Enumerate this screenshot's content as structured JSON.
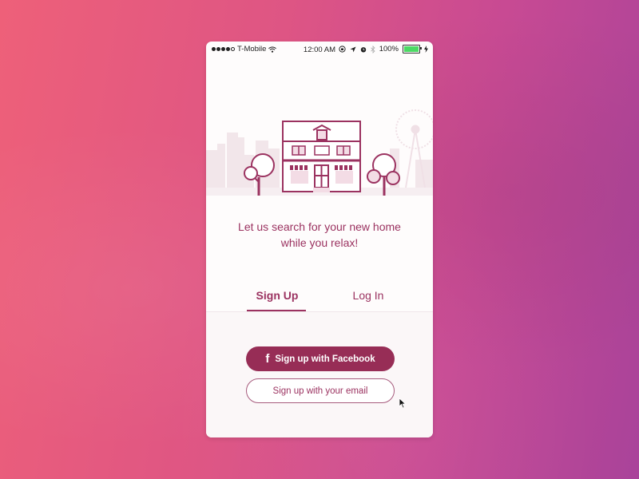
{
  "status_bar": {
    "carrier": "T-Mobile",
    "signal_bars_filled": 4,
    "signal_bars_total": 5,
    "time": "12:00 AM",
    "battery_percent": "100%",
    "icons": [
      "wifi-icon",
      "orientation-lock-icon",
      "location-arrow-icon",
      "alarm-icon",
      "bluetooth-icon",
      "battery-icon",
      "charging-bolt-icon"
    ]
  },
  "illustration": {
    "description": "house-with-trees-and-city-skyline",
    "accent_color": "#9b3260"
  },
  "tagline": {
    "line1": "Let us search for your new home",
    "line2": "while you relax!"
  },
  "tabs": [
    {
      "label": "Sign Up",
      "active": true
    },
    {
      "label": "Log In",
      "active": false
    }
  ],
  "buttons": {
    "facebook_icon": "f",
    "facebook_label": "Sign up with Facebook",
    "email_label": "Sign up with your email"
  },
  "colors": {
    "primary": "#972d56",
    "text_accent": "#9b3260",
    "background_start": "#ee6079",
    "background_end": "#a9439a"
  }
}
